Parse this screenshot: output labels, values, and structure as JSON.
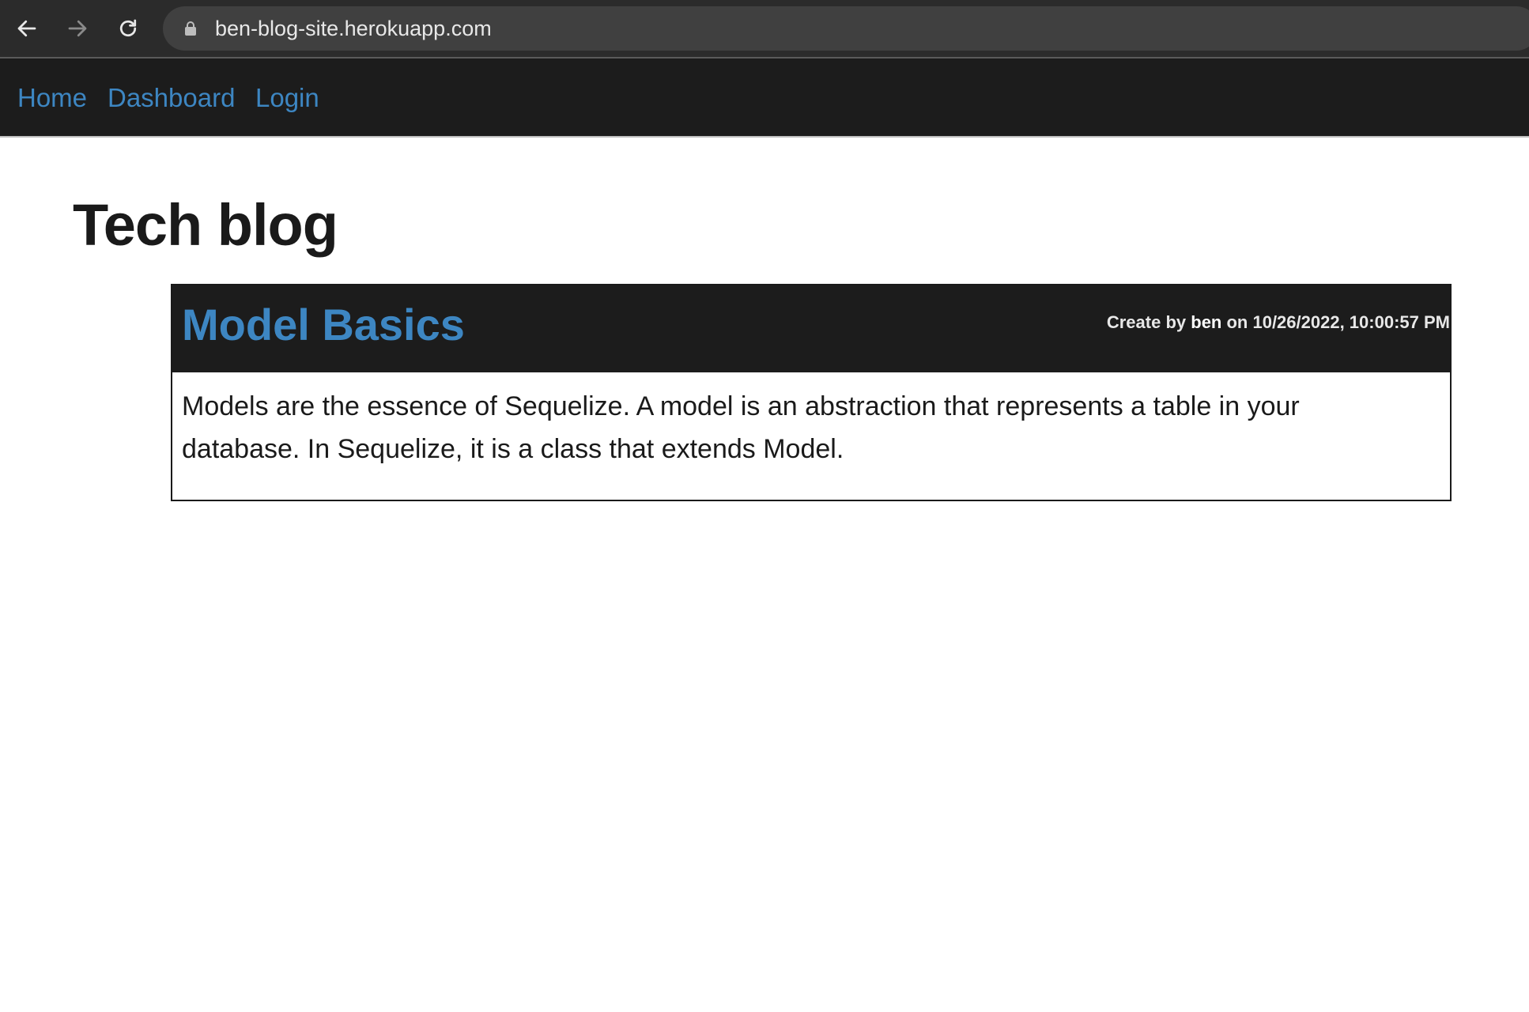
{
  "browser": {
    "url": "ben-blog-site.herokuapp.com",
    "icons": {
      "back": "arrow-left-icon",
      "forward": "arrow-right-icon",
      "reload": "reload-icon",
      "lock": "lock-icon"
    }
  },
  "nav": {
    "home": "Home",
    "dashboard": "Dashboard",
    "login": "Login"
  },
  "page": {
    "title": "Tech blog"
  },
  "posts": [
    {
      "title": "Model Basics",
      "meta_prefix": "Create by ",
      "author": "ben",
      "meta_suffix": " on 10/26/2022, 10:00:57 PM",
      "body": "Models are the essence of Sequelize. A model is an abstraction that represents a table in your database. In Sequelize, it is a class that extends Model."
    }
  ],
  "colors": {
    "link": "#3d86c2",
    "header_bg": "#1c1c1c",
    "chrome_bg": "#2b2b2b",
    "address_bg": "#404040"
  }
}
